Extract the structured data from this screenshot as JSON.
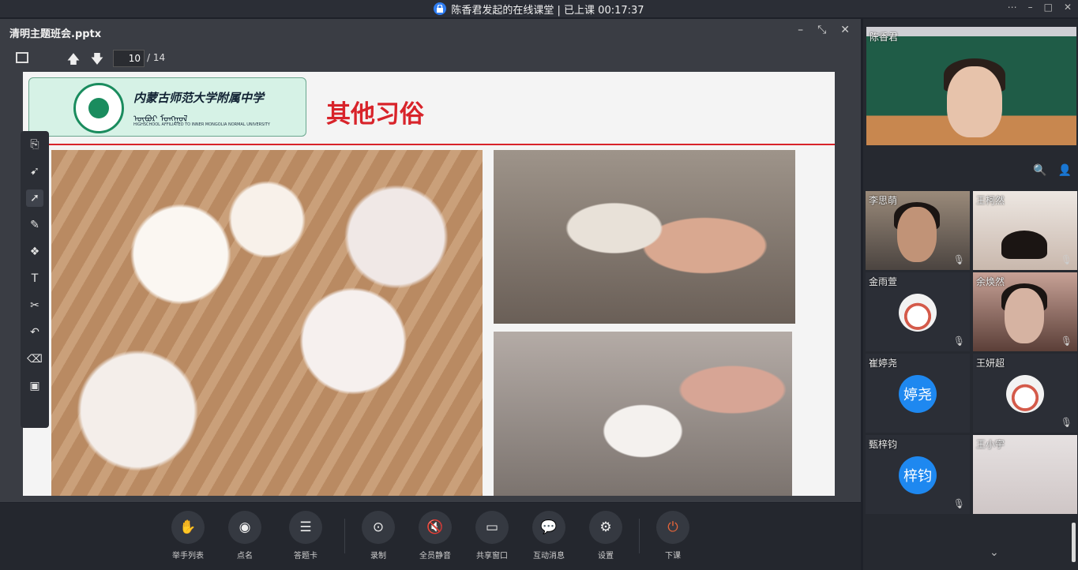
{
  "topbar": {
    "title": "陈香君发起的在线课堂 | 已上课 00:17:37"
  },
  "viewer": {
    "file_name": "清明主题班会.pptx",
    "current_page": "10",
    "total_pages": "/ 14"
  },
  "slide": {
    "school_name": "内蒙古师范大学附属中学",
    "school_mongolian": "ᠥᠪᠥᠷ ᠮᠣᠩᠭᠣᠯ",
    "school_english": "HIGHSCHOOL AFFILIATED TO INNER MONGOLIA NORMAL UNIVERSITY",
    "title": "其他习俗",
    "accent_color": "#d8232a"
  },
  "toolbar": {
    "items": [
      {
        "label": "举手列表",
        "icon": "hand-icon"
      },
      {
        "label": "点名",
        "icon": "roll-call-icon"
      },
      {
        "label": "答题卡",
        "icon": "answer-card-icon"
      },
      {
        "label": "录制",
        "icon": "record-icon"
      },
      {
        "label": "全员静音",
        "icon": "mute-all-icon"
      },
      {
        "label": "共享窗口",
        "icon": "share-window-icon"
      },
      {
        "label": "互动消息",
        "icon": "message-icon"
      },
      {
        "label": "设置",
        "icon": "settings-icon"
      },
      {
        "label": "下课",
        "icon": "power-icon"
      }
    ],
    "power_color": "#e8663a"
  },
  "participants": {
    "teacher": "陈香君",
    "tiles": [
      {
        "name": "李思萌",
        "type": "video"
      },
      {
        "name": "王柯然",
        "type": "video"
      },
      {
        "name": "金雨萱",
        "type": "image-avatar"
      },
      {
        "name": "余焕然",
        "type": "video"
      },
      {
        "name": "崔婷尧",
        "type": "text-avatar",
        "avatar_text": "婷尧"
      },
      {
        "name": "王妍超",
        "type": "image-avatar"
      },
      {
        "name": "甄梓钧",
        "type": "text-avatar",
        "avatar_text": "梓钧"
      },
      {
        "name": "王小宇",
        "type": "video"
      }
    ],
    "avatar_color": "#1e88f0"
  }
}
